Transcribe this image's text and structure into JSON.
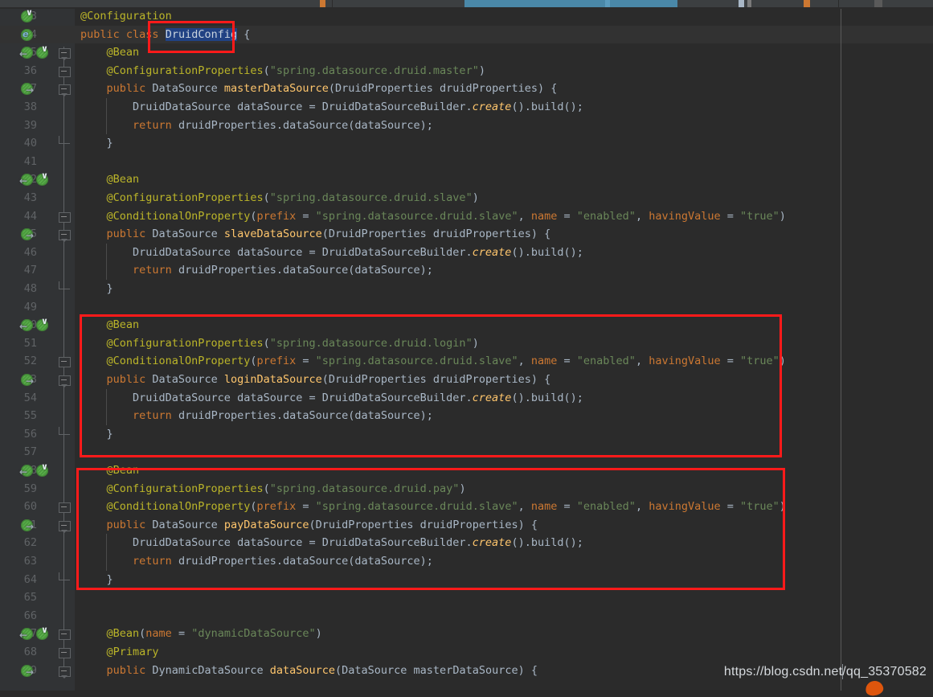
{
  "app": {
    "theme": "darcula",
    "colors": {
      "background": "#2b2b2b",
      "gutter": "#313335",
      "caret_row": "#323232",
      "keyword": "#cc7832",
      "annotation": "#bbb529",
      "string": "#6a8759",
      "method": "#ffc66d",
      "identifier": "#a9b7c6",
      "selection": "#214283",
      "annotation_box": "#ff1a1a",
      "line_number": "#606366"
    }
  },
  "breadcrumb": {
    "active_segment_color": "#4a88a8"
  },
  "watermark": {
    "url": "https://blog.csdn.net/qq_35370582"
  },
  "editor": {
    "first_visible_line": 33,
    "caret_line": 34,
    "selection_text": "DruidConfig",
    "lines": [
      {
        "n": 33,
        "segs": [
          {
            "t": "@Configuration",
            "c": "ann"
          }
        ]
      },
      {
        "n": 34,
        "segs": [
          {
            "t": "public ",
            "c": "kw"
          },
          {
            "t": "class ",
            "c": "kw"
          },
          {
            "t": "DruidConfig",
            "c": "sel"
          },
          {
            "t": " {",
            "c": "id"
          }
        ]
      },
      {
        "n": 35,
        "segs": [
          {
            "t": "    ",
            "c": "id"
          },
          {
            "t": "@Bean",
            "c": "ann"
          }
        ]
      },
      {
        "n": 36,
        "segs": [
          {
            "t": "    ",
            "c": "id"
          },
          {
            "t": "@ConfigurationProperties",
            "c": "ann"
          },
          {
            "t": "(",
            "c": "pm"
          },
          {
            "t": "\"spring.datasource.druid.master\"",
            "c": "str"
          },
          {
            "t": ")",
            "c": "pm"
          }
        ]
      },
      {
        "n": 37,
        "segs": [
          {
            "t": "    ",
            "c": "id"
          },
          {
            "t": "public ",
            "c": "kw"
          },
          {
            "t": "DataSource ",
            "c": "id"
          },
          {
            "t": "masterDataSource",
            "c": "mth"
          },
          {
            "t": "(DruidProperties druidProperties) {",
            "c": "id"
          }
        ]
      },
      {
        "n": 38,
        "segs": [
          {
            "t": "        DruidDataSource dataSource = DruidDataSourceBuilder.",
            "c": "id"
          },
          {
            "t": "create",
            "c": "mthi"
          },
          {
            "t": "().build()",
            "c": "id"
          },
          {
            "t": ";",
            "c": "pm"
          }
        ]
      },
      {
        "n": 39,
        "segs": [
          {
            "t": "        ",
            "c": "id"
          },
          {
            "t": "return ",
            "c": "kw"
          },
          {
            "t": "druidProperties.dataSource(dataSource)",
            "c": "id"
          },
          {
            "t": ";",
            "c": "pm"
          }
        ]
      },
      {
        "n": 40,
        "segs": [
          {
            "t": "    }",
            "c": "id"
          }
        ]
      },
      {
        "n": 41,
        "segs": []
      },
      {
        "n": 42,
        "segs": [
          {
            "t": "    ",
            "c": "id"
          },
          {
            "t": "@Bean",
            "c": "ann"
          }
        ]
      },
      {
        "n": 43,
        "segs": [
          {
            "t": "    ",
            "c": "id"
          },
          {
            "t": "@ConfigurationProperties",
            "c": "ann"
          },
          {
            "t": "(",
            "c": "pm"
          },
          {
            "t": "\"spring.datasource.druid.slave\"",
            "c": "str"
          },
          {
            "t": ")",
            "c": "pm"
          }
        ]
      },
      {
        "n": 44,
        "segs": [
          {
            "t": "    ",
            "c": "id"
          },
          {
            "t": "@ConditionalOnProperty",
            "c": "ann"
          },
          {
            "t": "(",
            "c": "pm"
          },
          {
            "t": "prefix ",
            "c": "kw"
          },
          {
            "t": "= ",
            "c": "id"
          },
          {
            "t": "\"spring.datasource.druid.slave\"",
            "c": "str"
          },
          {
            "t": ", ",
            "c": "id"
          },
          {
            "t": "name ",
            "c": "kw"
          },
          {
            "t": "= ",
            "c": "id"
          },
          {
            "t": "\"enabled\"",
            "c": "str"
          },
          {
            "t": ", ",
            "c": "id"
          },
          {
            "t": "havingValue ",
            "c": "kw"
          },
          {
            "t": "= ",
            "c": "id"
          },
          {
            "t": "\"true\"",
            "c": "str"
          },
          {
            "t": ")",
            "c": "pm"
          }
        ]
      },
      {
        "n": 45,
        "segs": [
          {
            "t": "    ",
            "c": "id"
          },
          {
            "t": "public ",
            "c": "kw"
          },
          {
            "t": "DataSource ",
            "c": "id"
          },
          {
            "t": "slaveDataSource",
            "c": "mth"
          },
          {
            "t": "(DruidProperties druidProperties) {",
            "c": "id"
          }
        ]
      },
      {
        "n": 46,
        "segs": [
          {
            "t": "        DruidDataSource dataSource = DruidDataSourceBuilder.",
            "c": "id"
          },
          {
            "t": "create",
            "c": "mthi"
          },
          {
            "t": "().build()",
            "c": "id"
          },
          {
            "t": ";",
            "c": "pm"
          }
        ]
      },
      {
        "n": 47,
        "segs": [
          {
            "t": "        ",
            "c": "id"
          },
          {
            "t": "return ",
            "c": "kw"
          },
          {
            "t": "druidProperties.dataSource(dataSource)",
            "c": "id"
          },
          {
            "t": ";",
            "c": "pm"
          }
        ]
      },
      {
        "n": 48,
        "segs": [
          {
            "t": "    }",
            "c": "id"
          }
        ]
      },
      {
        "n": 49,
        "segs": []
      },
      {
        "n": 50,
        "segs": [
          {
            "t": "    ",
            "c": "id"
          },
          {
            "t": "@Bean",
            "c": "ann"
          }
        ]
      },
      {
        "n": 51,
        "segs": [
          {
            "t": "    ",
            "c": "id"
          },
          {
            "t": "@ConfigurationProperties",
            "c": "ann"
          },
          {
            "t": "(",
            "c": "pm"
          },
          {
            "t": "\"spring.datasource.druid.login\"",
            "c": "str"
          },
          {
            "t": ")",
            "c": "pm"
          }
        ]
      },
      {
        "n": 52,
        "segs": [
          {
            "t": "    ",
            "c": "id"
          },
          {
            "t": "@ConditionalOnProperty",
            "c": "ann"
          },
          {
            "t": "(",
            "c": "pm"
          },
          {
            "t": "prefix ",
            "c": "kw"
          },
          {
            "t": "= ",
            "c": "id"
          },
          {
            "t": "\"spring.datasource.druid.slave\"",
            "c": "str"
          },
          {
            "t": ", ",
            "c": "id"
          },
          {
            "t": "name ",
            "c": "kw"
          },
          {
            "t": "= ",
            "c": "id"
          },
          {
            "t": "\"enabled\"",
            "c": "str"
          },
          {
            "t": ", ",
            "c": "id"
          },
          {
            "t": "havingValue ",
            "c": "kw"
          },
          {
            "t": "= ",
            "c": "id"
          },
          {
            "t": "\"true\"",
            "c": "str"
          },
          {
            "t": ")",
            "c": "pm"
          }
        ]
      },
      {
        "n": 53,
        "segs": [
          {
            "t": "    ",
            "c": "id"
          },
          {
            "t": "public ",
            "c": "kw"
          },
          {
            "t": "DataSource ",
            "c": "id"
          },
          {
            "t": "loginDataSource",
            "c": "mth"
          },
          {
            "t": "(DruidProperties druidProperties) {",
            "c": "id"
          }
        ]
      },
      {
        "n": 54,
        "segs": [
          {
            "t": "        DruidDataSource dataSource = DruidDataSourceBuilder.",
            "c": "id"
          },
          {
            "t": "create",
            "c": "mthi"
          },
          {
            "t": "().build()",
            "c": "id"
          },
          {
            "t": ";",
            "c": "pm"
          }
        ]
      },
      {
        "n": 55,
        "segs": [
          {
            "t": "        ",
            "c": "id"
          },
          {
            "t": "return ",
            "c": "kw"
          },
          {
            "t": "druidProperties.dataSource(dataSource)",
            "c": "id"
          },
          {
            "t": ";",
            "c": "pm"
          }
        ]
      },
      {
        "n": 56,
        "segs": [
          {
            "t": "    }",
            "c": "id"
          }
        ]
      },
      {
        "n": 57,
        "segs": []
      },
      {
        "n": 58,
        "segs": [
          {
            "t": "    ",
            "c": "id"
          },
          {
            "t": "@Bean",
            "c": "ann"
          }
        ]
      },
      {
        "n": 59,
        "segs": [
          {
            "t": "    ",
            "c": "id"
          },
          {
            "t": "@ConfigurationProperties",
            "c": "ann"
          },
          {
            "t": "(",
            "c": "pm"
          },
          {
            "t": "\"spring.datasource.druid.pay\"",
            "c": "str"
          },
          {
            "t": ")",
            "c": "pm"
          }
        ]
      },
      {
        "n": 60,
        "segs": [
          {
            "t": "    ",
            "c": "id"
          },
          {
            "t": "@ConditionalOnProperty",
            "c": "ann"
          },
          {
            "t": "(",
            "c": "pm"
          },
          {
            "t": "prefix ",
            "c": "kw"
          },
          {
            "t": "= ",
            "c": "id"
          },
          {
            "t": "\"spring.datasource.druid.slave\"",
            "c": "str"
          },
          {
            "t": ", ",
            "c": "id"
          },
          {
            "t": "name ",
            "c": "kw"
          },
          {
            "t": "= ",
            "c": "id"
          },
          {
            "t": "\"enabled\"",
            "c": "str"
          },
          {
            "t": ", ",
            "c": "id"
          },
          {
            "t": "havingValue ",
            "c": "kw"
          },
          {
            "t": "= ",
            "c": "id"
          },
          {
            "t": "\"true\"",
            "c": "str"
          },
          {
            "t": ")",
            "c": "pm"
          }
        ]
      },
      {
        "n": 61,
        "segs": [
          {
            "t": "    ",
            "c": "id"
          },
          {
            "t": "public ",
            "c": "kw"
          },
          {
            "t": "DataSource ",
            "c": "id"
          },
          {
            "t": "payDataSource",
            "c": "mth"
          },
          {
            "t": "(DruidProperties druidProperties) {",
            "c": "id"
          }
        ]
      },
      {
        "n": 62,
        "segs": [
          {
            "t": "        DruidDataSource dataSource = DruidDataSourceBuilder.",
            "c": "id"
          },
          {
            "t": "create",
            "c": "mthi"
          },
          {
            "t": "().build()",
            "c": "id"
          },
          {
            "t": ";",
            "c": "pm"
          }
        ]
      },
      {
        "n": 63,
        "segs": [
          {
            "t": "        ",
            "c": "id"
          },
          {
            "t": "return ",
            "c": "kw"
          },
          {
            "t": "druidProperties.dataSource(dataSource)",
            "c": "id"
          },
          {
            "t": ";",
            "c": "pm"
          }
        ]
      },
      {
        "n": 64,
        "segs": [
          {
            "t": "    }",
            "c": "id"
          }
        ]
      },
      {
        "n": 65,
        "segs": []
      },
      {
        "n": 66,
        "segs": []
      },
      {
        "n": 67,
        "segs": [
          {
            "t": "    ",
            "c": "id"
          },
          {
            "t": "@Bean",
            "c": "ann"
          },
          {
            "t": "(",
            "c": "pm"
          },
          {
            "t": "name ",
            "c": "kw"
          },
          {
            "t": "= ",
            "c": "id"
          },
          {
            "t": "\"dynamicDataSource\"",
            "c": "str"
          },
          {
            "t": ")",
            "c": "pm"
          }
        ]
      },
      {
        "n": 68,
        "segs": [
          {
            "t": "    ",
            "c": "id"
          },
          {
            "t": "@Primary",
            "c": "ann"
          }
        ]
      },
      {
        "n": 69,
        "segs": [
          {
            "t": "    ",
            "c": "id"
          },
          {
            "t": "public ",
            "c": "kw"
          },
          {
            "t": "DynamicDataSource ",
            "c": "id"
          },
          {
            "t": "dataSource",
            "c": "mth"
          },
          {
            "t": "(DataSource masterDataSource) {",
            "c": "id"
          }
        ]
      }
    ],
    "gutter_icons": [
      {
        "line": 33,
        "icons": [
          "bean-check"
        ]
      },
      {
        "line": 34,
        "icons": [
          "bean-e"
        ]
      },
      {
        "line": 35,
        "icons": [
          "bean-left",
          "bean-check"
        ]
      },
      {
        "line": 37,
        "icons": [
          "bean-right"
        ]
      },
      {
        "line": 42,
        "icons": [
          "bean-left",
          "bean-check"
        ]
      },
      {
        "line": 45,
        "icons": [
          "bean-right"
        ]
      },
      {
        "line": 50,
        "icons": [
          "bean-left",
          "bean-check"
        ]
      },
      {
        "line": 53,
        "icons": [
          "bean-right"
        ]
      },
      {
        "line": 58,
        "icons": [
          "bean-left",
          "bean-check"
        ]
      },
      {
        "line": 61,
        "icons": [
          "bean-right"
        ]
      },
      {
        "line": 67,
        "icons": [
          "bean-left",
          "bean-check"
        ]
      },
      {
        "line": 69,
        "icons": [
          "bean-right"
        ]
      }
    ],
    "fold_markers": [
      35,
      36,
      37,
      40,
      44,
      45,
      48,
      52,
      53,
      56,
      60,
      61,
      64,
      67,
      68,
      69
    ],
    "annotation_boxes": [
      {
        "name": "login-datasource-highlight",
        "from_line": 50,
        "to_line": 56
      },
      {
        "name": "pay-datasource-highlight",
        "from_line": 58,
        "to_line": 63
      },
      {
        "name": "class-name-highlight",
        "line": 34
      }
    ]
  }
}
